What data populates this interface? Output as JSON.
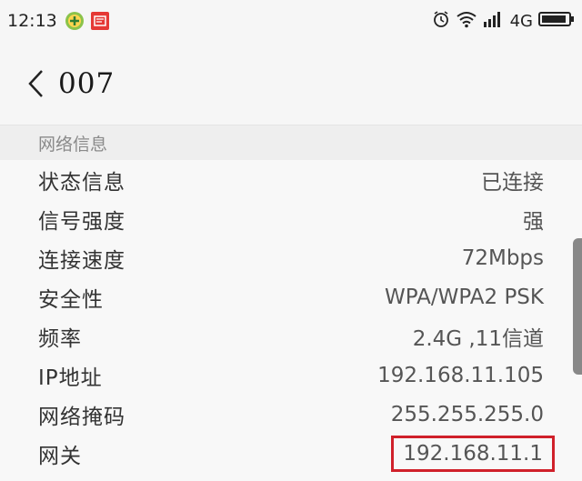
{
  "status_bar": {
    "time": "12:13",
    "notification_icons": [
      "plus-badge-icon",
      "app-badge-icon"
    ],
    "right_icons": [
      "alarm-icon",
      "wifi-icon",
      "signal-icon",
      "battery-icon"
    ],
    "network_label": "4G"
  },
  "app_bar": {
    "back_icon": "chevron-left-icon",
    "title": "007"
  },
  "section": {
    "header": "网络信息"
  },
  "rows": [
    {
      "label": "状态信息",
      "value": "已连接"
    },
    {
      "label": "信号强度",
      "value": "强"
    },
    {
      "label": "连接速度",
      "value": "72Mbps"
    },
    {
      "label": "安全性",
      "value": "WPA/WPA2 PSK"
    },
    {
      "label": "频率",
      "value": "2.4G ,11信道"
    },
    {
      "label": "IP地址",
      "value": "192.168.11.105"
    },
    {
      "label": "网络掩码",
      "value": "255.255.255.0"
    },
    {
      "label": "网关",
      "value": "192.168.11.1"
    }
  ],
  "colors": {
    "highlight_border": "#d0202a",
    "background": "#f6f6f6"
  }
}
